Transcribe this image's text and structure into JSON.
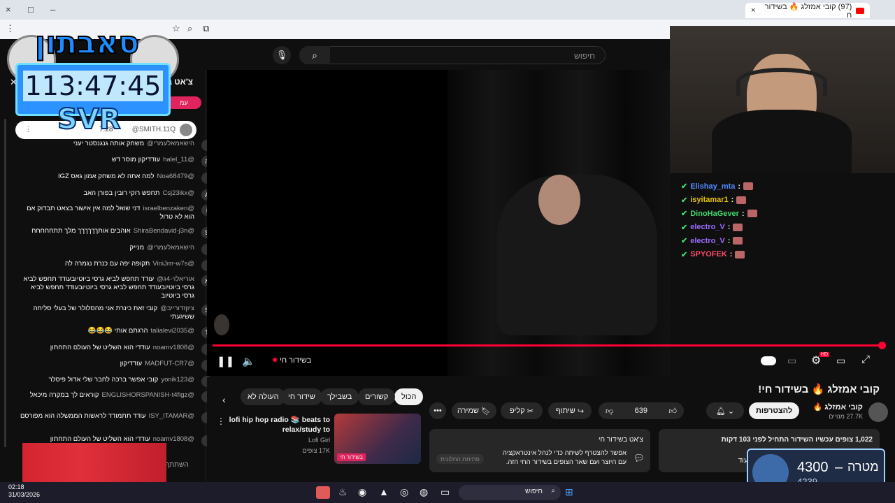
{
  "browser": {
    "tab_title": "(97) קובי אמזלג 🔥 בשידור ח",
    "close": "×",
    "new_tab": "+",
    "min": "–",
    "max": "□",
    "close_win": "×"
  },
  "youtube": {
    "search_placeholder": "חיפוש"
  },
  "overlay": {
    "timer": "113:47:45",
    "timer_sub": "SVR",
    "logo_text": "סאבתון"
  },
  "chat": {
    "title": "צ'אט ב",
    "top_button": "עמ",
    "pinned": {
      "author": "@SMITH.11Q",
      "time": "7:28"
    },
    "messages": [
      {
        "author": "הישאמאלעמרי@",
        "text": "משחק אותה גנגנסטר יעני",
        "av": ""
      },
      {
        "author": "@halel_11",
        "text": "עודדיקון מוסר דש",
        "av": "ה"
      },
      {
        "author": "@Noa68479",
        "text": "למה אתה לא משחק אמון גאס IGZ",
        "av": ""
      },
      {
        "author": "@Csj23ikx",
        "text": "תחפש רוקי רובין בפורן האב",
        "av": "A"
      },
      {
        "author": "@israelbenzaken",
        "text": "דני שואל למה אין אישור בצאט תבדוק אם הוא לא טרול",
        "av": "i"
      },
      {
        "author": "@ShiraBendavid-j3n",
        "text": "אוהבים אותךךךךךך מלך תתחחחחח",
        "av": "S"
      },
      {
        "author": "הישאמאלעמרי@",
        "text": "מנייק",
        "av": ""
      },
      {
        "author": "@ViniJrrr-w7s",
        "text": "תקופה יפה עם כנרת נגמרה לה",
        "av": ""
      },
      {
        "author": "אוריאלוי-4ג@",
        "text": "עודד תחפש לביא גרסי ביוטיובעודד תחפש לביא גרסי ביוטיובעודד תחפש לביא גרסי ביוטיובעודד תחפש לביא גרסי ביוטיוב",
        "av": "א"
      },
      {
        "author": "ציוןזדורייב@",
        "text": "קובי זאת כינרת אני מהסלולר של בעלי סליחה ששיגעתי",
        "av": "S"
      },
      {
        "author": "@talialevi2035",
        "text": "הרגתם אותי 😂😂😂",
        "av": "T"
      },
      {
        "author": "@noamv1808",
        "text": "עודדי הוא השליט של העולם התחתון",
        "av": ""
      },
      {
        "author": "@MADFUT-CR7",
        "text": "עודדיקון",
        "av": ""
      },
      {
        "author": "@yonik123",
        "text": "קובי אפשר ברכה לחבר שלי אדול פיסלר",
        "av": ""
      },
      {
        "author": "@ENGLISHORSPANISH-t4figz",
        "text": "קוראים לך במקרה מיכאל",
        "av": ""
      },
      {
        "author": "@ISY_ITAMAR",
        "text": "עודד תתמודד לראשות הממשלה הוא מפורסם",
        "av": ""
      },
      {
        "author": "@noamv1808",
        "text": "עודדי הוא השליט של העולם התחתון",
        "av": ""
      }
    ],
    "input_partial": "השתתף"
  },
  "player": {
    "live_label": "בשידור חי",
    "hd": "HD"
  },
  "twitch_chat": [
    {
      "name": "Elishay_mta",
      "color": "#4f8cff"
    },
    {
      "name": "isyitamar1",
      "color": "#e6c200"
    },
    {
      "name": "DinoHaGever",
      "color": "#41d96e"
    },
    {
      "name": "electro_V",
      "color": "#9a6bff"
    },
    {
      "name": "electro_V",
      "color": "#9a6bff"
    },
    {
      "name": "SPYOFEK",
      "color": "#ff4a6a"
    }
  ],
  "video_info": {
    "title": "קובי אמזלג 🔥 בשידור חי!",
    "channel": "קובי אמזלג 🔥",
    "subscribers": "27.7K מנויים",
    "subscribe": "להצטרפות",
    "likes": "639",
    "share": "שיתוף",
    "clip": "קליפ",
    "save": "שמירה",
    "more": "•••",
    "watching": "1,022 צופים עכשיו  השידור התחיל לפני 103 דקות",
    "desc_more": "עוד...",
    "live_chat_title": "צ'אט בשידור חי",
    "live_chat_desc": "אפשר להצטרף לשיחה כדי לנהל אינטראקציה עם היוצר ועם שאר הצופים בשידור החי הזה.",
    "open_panel": "פתיחת החלונית"
  },
  "filters": [
    "הכול",
    "קשורים",
    "בשבילך",
    "שידור חי",
    "העולה לא"
  ],
  "recommended": {
    "title": "lofi hip hop radio 📚 beats to relax/study to",
    "channel": "Lofi Girl",
    "views": "17K צופים",
    "badge": "בשידור חי"
  },
  "goal": {
    "label": "מטרה",
    "current": "4300",
    "target": "4239",
    "dash": "–"
  },
  "taskbar": {
    "search": "חיפוש",
    "time": "02:18",
    "date": "31/03/2026"
  }
}
